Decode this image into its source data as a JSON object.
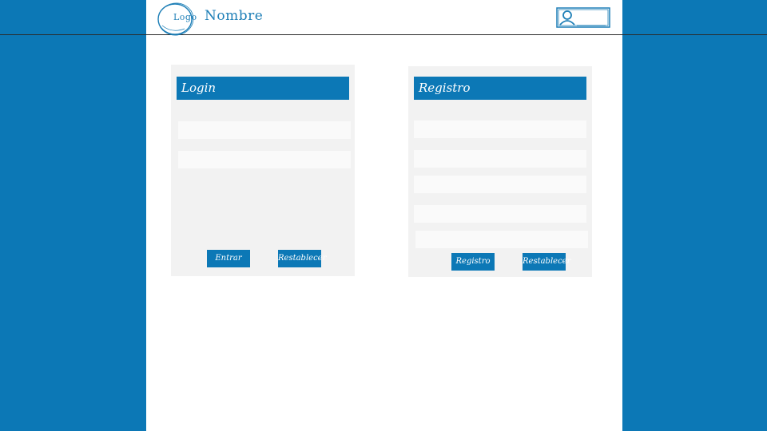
{
  "header": {
    "logo_text": "Logo",
    "brand_name": "Nombre",
    "user_icon": "user-icon"
  },
  "login": {
    "title": "Login",
    "username_value": "",
    "password_value": "",
    "submit_label": "Entrar",
    "reset_label": "Restablecer"
  },
  "register": {
    "title": "Registro",
    "fields": [
      "",
      "",
      "",
      "",
      ""
    ],
    "submit_label": "Registro",
    "reset_label": "Restablecer"
  },
  "colors": {
    "accent": "#0c78b6",
    "panel_bg": "#f2f2f2",
    "field_bg": "#fafafa",
    "page_bg": "#ffffff"
  }
}
